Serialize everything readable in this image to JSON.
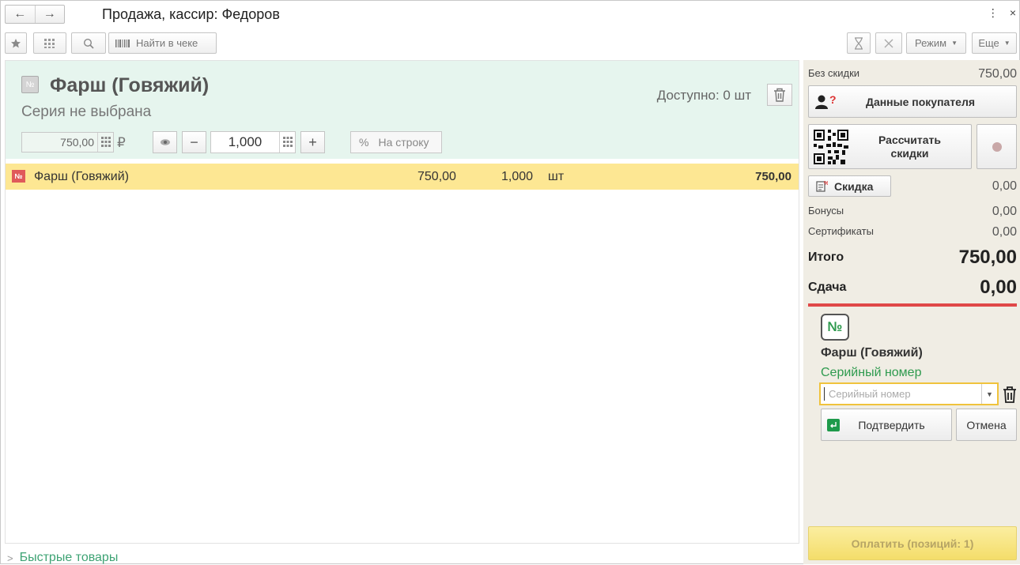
{
  "window": {
    "title": "Продажа, кассир: Федоров",
    "back_icon": "←",
    "forward_icon": "→",
    "more_icon": "⋮",
    "close_icon": "×"
  },
  "toolbar": {
    "find_in_receipt": "Найти в чеке",
    "mode_label": "Режим",
    "more_label": "Еще"
  },
  "item_card": {
    "badge": "№",
    "name": "Фарш (Говяжий)",
    "series_status": "Серия не выбрана",
    "available": "Доступно: 0 шт",
    "price": "750,00",
    "currency": "₽",
    "quantity": "1,000",
    "per_line_button": "На строку",
    "percent_symbol": "%",
    "minus": "−",
    "plus": "+"
  },
  "receipt_lines": [
    {
      "badge": "№",
      "name": "Фарш (Говяжий)",
      "price": "750,00",
      "quantity": "1,000",
      "unit": "шт",
      "sum": "750,00"
    }
  ],
  "quick_items": {
    "arrow": ">",
    "label": "Быстрые товары"
  },
  "summary": {
    "no_discount_label": "Без скидки",
    "no_discount_value": "750,00",
    "customer_data_button": "Данные покупателя",
    "calc_discounts_line1": "Рассчитать",
    "calc_discounts_line2": "скидки",
    "discount_button": "Скидка",
    "discount_value": "0,00",
    "bonuses_label": "Бонусы",
    "bonuses_value": "0,00",
    "certificates_label": "Сертификаты",
    "certificates_value": "0,00",
    "total_label": "Итого",
    "total_value": "750,00",
    "change_label": "Сдача",
    "change_value": "0,00"
  },
  "serial_panel": {
    "badge": "№",
    "product_name": "Фарш (Говяжий)",
    "serial_label": "Серийный номер",
    "serial_placeholder": "Серийный номер",
    "confirm_button": "Подтвердить",
    "cancel_button": "Отмена"
  },
  "pay_button": "Оплатить (позиций: 1)"
}
